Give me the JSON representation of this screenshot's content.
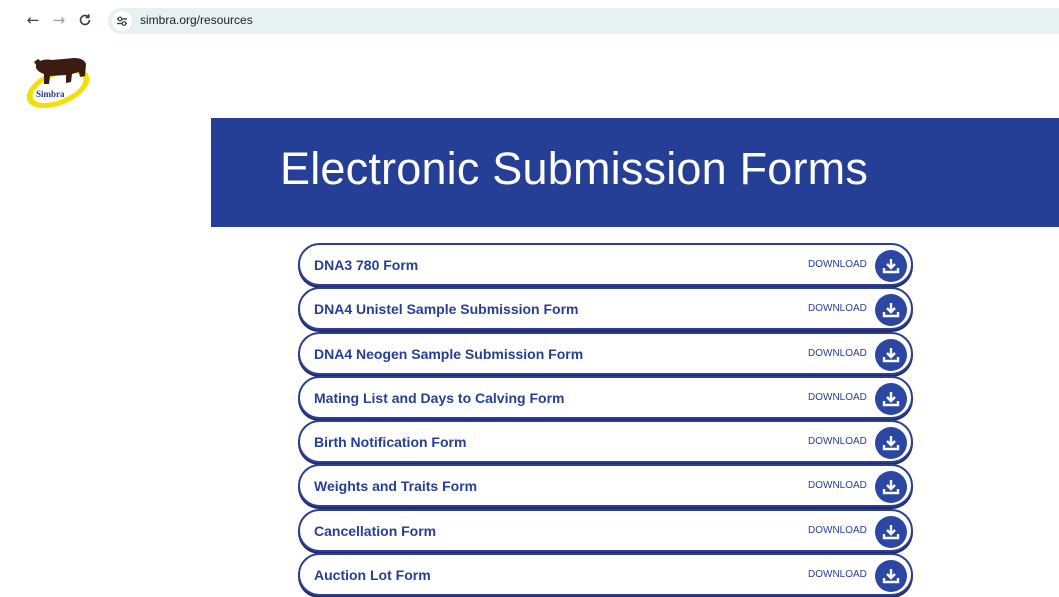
{
  "browser": {
    "url": "simbra.org/resources"
  },
  "logo": {
    "text": "Simbra"
  },
  "banner": {
    "title": "Electronic Submission Forms"
  },
  "forms": [
    {
      "name": "DNA3 780 Form",
      "action": "DOWNLOAD"
    },
    {
      "name": "DNA4 Unistel Sample Submission Form",
      "action": "DOWNLOAD"
    },
    {
      "name": "DNA4 Neogen Sample Submission Form",
      "action": "DOWNLOAD"
    },
    {
      "name": "Mating List and Days to Calving Form",
      "action": "DOWNLOAD"
    },
    {
      "name": "Birth Notification Form",
      "action": "DOWNLOAD"
    },
    {
      "name": "Weights and Traits Form",
      "action": "DOWNLOAD"
    },
    {
      "name": "Cancellation Form",
      "action": "DOWNLOAD"
    },
    {
      "name": "Auction Lot Form",
      "action": "DOWNLOAD"
    }
  ],
  "colors": {
    "brand_blue": "#263f96",
    "logo_yellow": "#f2e000"
  }
}
